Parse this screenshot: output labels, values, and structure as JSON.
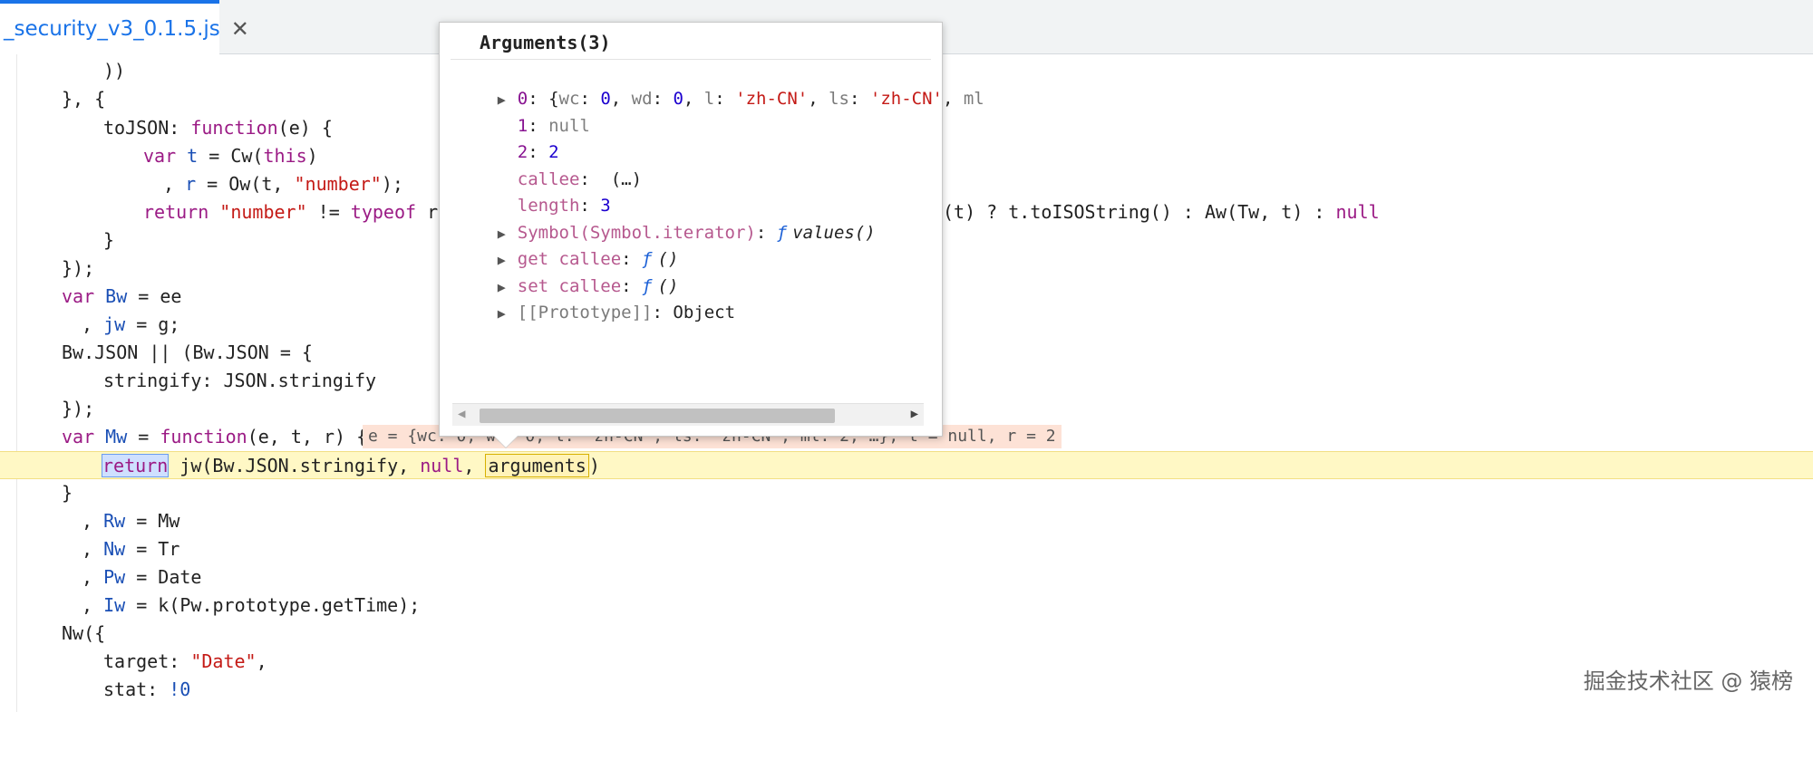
{
  "tab": {
    "filename": "_security_v3_0.1.5.js",
    "close_glyph": "✕"
  },
  "code": {
    "l1": "))",
    "l2": "}, {",
    "l3_key": "toJSON",
    "l3_colon": ": ",
    "l3_fn": "function",
    "l3_arg": "(e) {",
    "l4_var": "var",
    "l4_name": "t",
    "l4_rest": " = Cw(",
    "l4_this": "this",
    "l4_end": ")",
    "l5_comma": ", ",
    "l5_name": "r",
    "l5_rest": " = Ow(t, ",
    "l5_str": "\"number\"",
    "l5_end": ");",
    "l6_ret": "return",
    "l6_str": "\"number\"",
    "l6_ne": " != ",
    "l6_typeof": "typeof",
    "l6_rest": " r |",
    "l6_tail": "(t) ? t.toISOString() : Aw(Tw, t) : ",
    "l6_null": "null",
    "l7": "}",
    "l8": "});",
    "l9_var": "var",
    "l9_name": "Bw",
    "l9_rest": " = ee",
    "l10_comma": ", ",
    "l10_name": "jw",
    "l10_rest": " = g;",
    "l11": "Bw.JSON || (Bw.JSON = {",
    "l12": "stringify: JSON.stringify",
    "l13": "});",
    "l14_var": "var",
    "l14_name": "Mw",
    "l14_eq": " = ",
    "l14_fn": "function",
    "l14_rest": "(e, t, r) {",
    "l14_inline": "e = {wc: 0, wd: 0, l: 'zh-CN', ls: 'zh-CN', ml: 2, …}, t = null, r = 2",
    "l15_ret": "return",
    "l15_mid": " jw(Bw.JSON.stringify, ",
    "l15_null": "null",
    "l15_comma": ", ",
    "l15_args": "arguments",
    "l15_end": ")",
    "l16": "}",
    "l17_comma": ", ",
    "l17_name": "Rw",
    "l17_rest": " = Mw",
    "l18_comma": ", ",
    "l18_name": "Nw",
    "l18_rest": " = Tr",
    "l19_comma": ", ",
    "l19_name": "Pw",
    "l19_rest": " = Date",
    "l20_comma": ", ",
    "l20_name": "Iw",
    "l20_rest": " = k(Pw.prototype.getTime);",
    "l21": "Nw({",
    "l22_key": "target: ",
    "l22_str": "\"Date\"",
    "l22_end": ",",
    "l23_key": "stat: ",
    "l23_val": "!0"
  },
  "popover": {
    "title": "Arguments(3)",
    "r0_key": "0",
    "r0_colon": ": {",
    "r0_wc": "wc",
    "r0_sep1": ": ",
    "r0_v1": "0",
    "r0_c1": ", ",
    "r0_wd": "wd",
    "r0_v2": "0",
    "r0_l": "l",
    "r0_s1": "'zh-CN'",
    "r0_ls": "ls",
    "r0_s2": "'zh-CN'",
    "r0_ml": "ml",
    "r1_key": "1",
    "r1_val": "null",
    "r2_key": "2",
    "r2_val": "2",
    "r3_key": "callee",
    "r3_val": "(…)",
    "r4_key": "length",
    "r4_val": "3",
    "r5_key": "Symbol(Symbol.iterator)",
    "r5_val": "values()",
    "r6_key": "get callee",
    "r6_val": "()",
    "r7_key": "set callee",
    "r7_val": "()",
    "r8_key": "[[Prototype]]",
    "r8_val": "Object",
    "f_glyph": "ƒ",
    "expand_glyph": "▶"
  },
  "watermark": "掘金技术社区 @ 猿榜"
}
